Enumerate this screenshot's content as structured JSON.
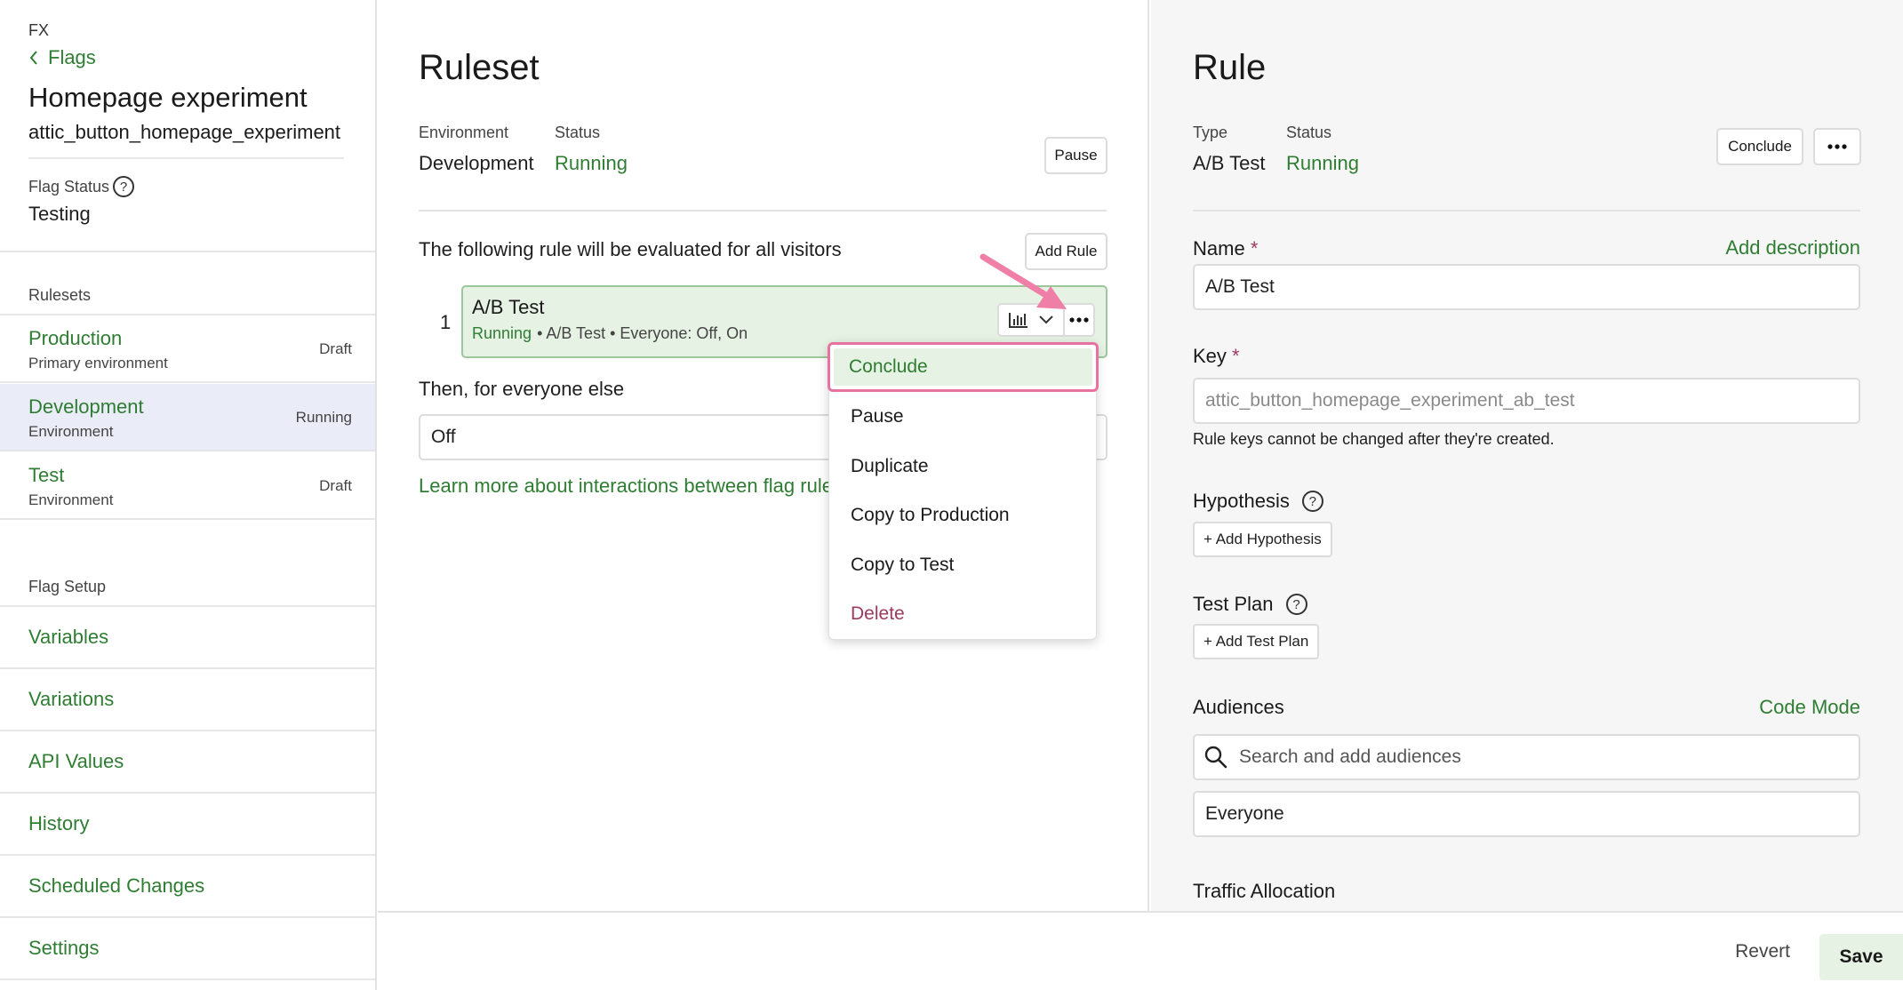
{
  "sidebar": {
    "project": "FX",
    "back_label": "Flags",
    "flag_title": "Homepage experiment",
    "flag_key": "attic_button_homepage_experiment",
    "flag_status_label": "Flag Status",
    "flag_status_value": "Testing",
    "rulesets_label": "Rulesets",
    "rulesets": [
      {
        "name": "Production",
        "sub": "Primary environment",
        "badge": "Draft"
      },
      {
        "name": "Development",
        "sub": "Environment",
        "badge": "Running"
      },
      {
        "name": "Test",
        "sub": "Environment",
        "badge": "Draft"
      }
    ],
    "setup_label": "Flag Setup",
    "setup_items": [
      "Variables",
      "Variations",
      "API Values",
      "History",
      "Scheduled Changes",
      "Settings"
    ]
  },
  "ruleset": {
    "title": "Ruleset",
    "environment_label": "Environment",
    "environment_value": "Development",
    "status_label": "Status",
    "status_value": "Running",
    "pause_label": "Pause",
    "intro": "The following rule will be evaluated for all visitors",
    "add_rule_label": "Add Rule",
    "rule": {
      "index": "1",
      "name": "A/B Test",
      "status": "Running",
      "details": "• A/B Test • Everyone: Off, On"
    },
    "then_label": "Then, for everyone else",
    "fallback_value": "Off",
    "learn_link": "Learn more about interactions between flag rules"
  },
  "menu": {
    "items": [
      "Conclude",
      "Pause",
      "Duplicate",
      "Copy to Production",
      "Copy to Test",
      "Delete"
    ]
  },
  "rule_panel": {
    "title": "Rule",
    "type_label": "Type",
    "type_value": "A/B Test",
    "status_label": "Status",
    "status_value": "Running",
    "conclude_label": "Conclude",
    "name_label": "Name",
    "add_description": "Add description",
    "name_value": "A/B Test",
    "key_label": "Key",
    "key_placeholder": "attic_button_homepage_experiment_ab_test",
    "key_hint": "Rule keys cannot be changed after they're created.",
    "hypothesis_label": "Hypothesis",
    "add_hypothesis": "+ Add Hypothesis",
    "test_plan_label": "Test Plan",
    "add_test_plan": "+ Add Test Plan",
    "audiences_label": "Audiences",
    "code_mode": "Code Mode",
    "audience_search_placeholder": "Search and add audiences",
    "audience_value": "Everyone",
    "traffic_label": "Traffic Allocation"
  },
  "footer": {
    "revert": "Revert",
    "save": "Save"
  },
  "colors": {
    "accent_green": "#2e7d32",
    "highlight_pink": "#e5729f",
    "danger": "#9c3a5e",
    "active_row": "#eaedf7"
  }
}
